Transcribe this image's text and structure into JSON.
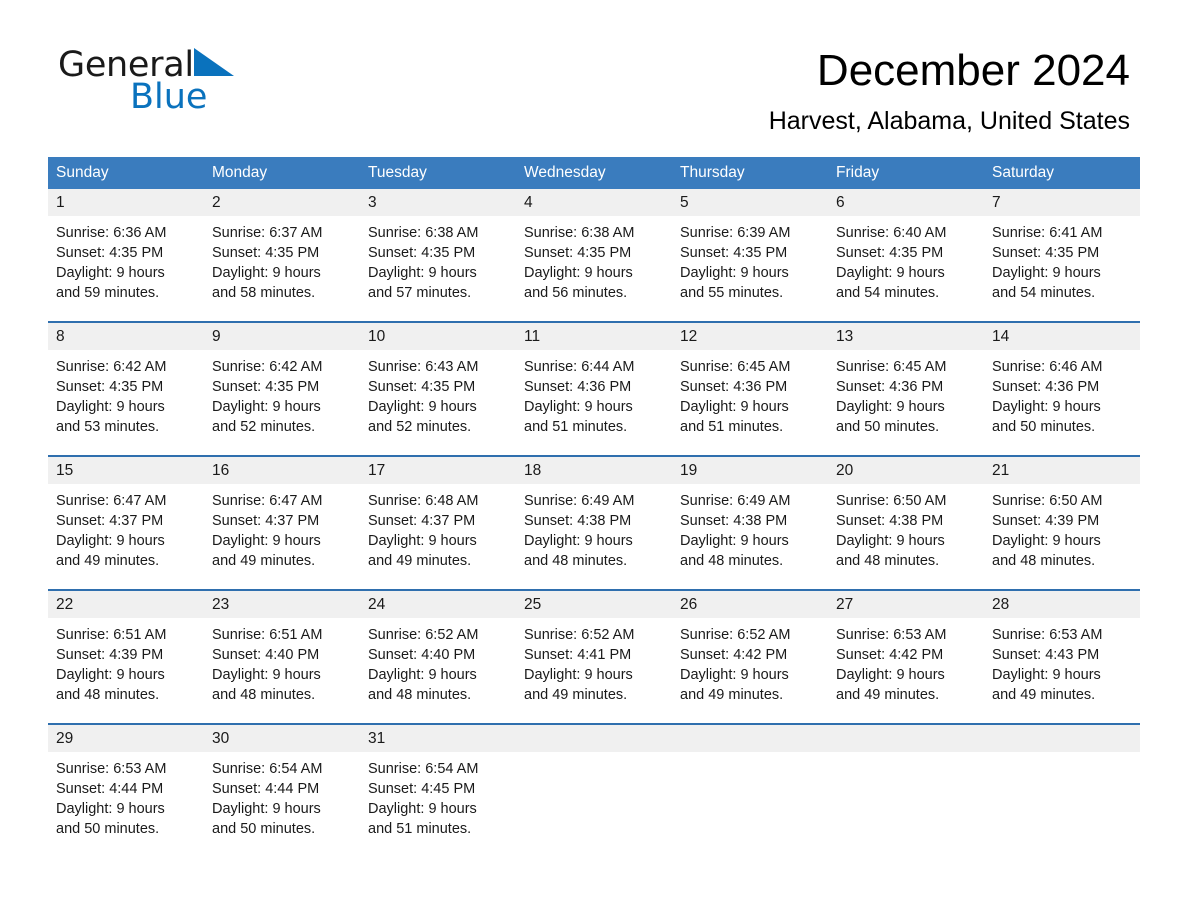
{
  "brand": {
    "name_part1": "General",
    "name_part2": "Blue",
    "triangle_icon": "blue-triangle-icon",
    "accent_color": "#0a72bd"
  },
  "header": {
    "title": "December 2024",
    "subtitle": "Harvest, Alabama, United States"
  },
  "calendar": {
    "header_bg": "#3a7cbe",
    "row_divider_color": "#2f6fae",
    "day_band_bg": "#f0f0f0",
    "weekdays": [
      "Sunday",
      "Monday",
      "Tuesday",
      "Wednesday",
      "Thursday",
      "Friday",
      "Saturday"
    ],
    "weeks": [
      [
        {
          "day": "1",
          "sunrise": "Sunrise: 6:36 AM",
          "sunset": "Sunset: 4:35 PM",
          "daylight1": "Daylight: 9 hours",
          "daylight2": "and 59 minutes."
        },
        {
          "day": "2",
          "sunrise": "Sunrise: 6:37 AM",
          "sunset": "Sunset: 4:35 PM",
          "daylight1": "Daylight: 9 hours",
          "daylight2": "and 58 minutes."
        },
        {
          "day": "3",
          "sunrise": "Sunrise: 6:38 AM",
          "sunset": "Sunset: 4:35 PM",
          "daylight1": "Daylight: 9 hours",
          "daylight2": "and 57 minutes."
        },
        {
          "day": "4",
          "sunrise": "Sunrise: 6:38 AM",
          "sunset": "Sunset: 4:35 PM",
          "daylight1": "Daylight: 9 hours",
          "daylight2": "and 56 minutes."
        },
        {
          "day": "5",
          "sunrise": "Sunrise: 6:39 AM",
          "sunset": "Sunset: 4:35 PM",
          "daylight1": "Daylight: 9 hours",
          "daylight2": "and 55 minutes."
        },
        {
          "day": "6",
          "sunrise": "Sunrise: 6:40 AM",
          "sunset": "Sunset: 4:35 PM",
          "daylight1": "Daylight: 9 hours",
          "daylight2": "and 54 minutes."
        },
        {
          "day": "7",
          "sunrise": "Sunrise: 6:41 AM",
          "sunset": "Sunset: 4:35 PM",
          "daylight1": "Daylight: 9 hours",
          "daylight2": "and 54 minutes."
        }
      ],
      [
        {
          "day": "8",
          "sunrise": "Sunrise: 6:42 AM",
          "sunset": "Sunset: 4:35 PM",
          "daylight1": "Daylight: 9 hours",
          "daylight2": "and 53 minutes."
        },
        {
          "day": "9",
          "sunrise": "Sunrise: 6:42 AM",
          "sunset": "Sunset: 4:35 PM",
          "daylight1": "Daylight: 9 hours",
          "daylight2": "and 52 minutes."
        },
        {
          "day": "10",
          "sunrise": "Sunrise: 6:43 AM",
          "sunset": "Sunset: 4:35 PM",
          "daylight1": "Daylight: 9 hours",
          "daylight2": "and 52 minutes."
        },
        {
          "day": "11",
          "sunrise": "Sunrise: 6:44 AM",
          "sunset": "Sunset: 4:36 PM",
          "daylight1": "Daylight: 9 hours",
          "daylight2": "and 51 minutes."
        },
        {
          "day": "12",
          "sunrise": "Sunrise: 6:45 AM",
          "sunset": "Sunset: 4:36 PM",
          "daylight1": "Daylight: 9 hours",
          "daylight2": "and 51 minutes."
        },
        {
          "day": "13",
          "sunrise": "Sunrise: 6:45 AM",
          "sunset": "Sunset: 4:36 PM",
          "daylight1": "Daylight: 9 hours",
          "daylight2": "and 50 minutes."
        },
        {
          "day": "14",
          "sunrise": "Sunrise: 6:46 AM",
          "sunset": "Sunset: 4:36 PM",
          "daylight1": "Daylight: 9 hours",
          "daylight2": "and 50 minutes."
        }
      ],
      [
        {
          "day": "15",
          "sunrise": "Sunrise: 6:47 AM",
          "sunset": "Sunset: 4:37 PM",
          "daylight1": "Daylight: 9 hours",
          "daylight2": "and 49 minutes."
        },
        {
          "day": "16",
          "sunrise": "Sunrise: 6:47 AM",
          "sunset": "Sunset: 4:37 PM",
          "daylight1": "Daylight: 9 hours",
          "daylight2": "and 49 minutes."
        },
        {
          "day": "17",
          "sunrise": "Sunrise: 6:48 AM",
          "sunset": "Sunset: 4:37 PM",
          "daylight1": "Daylight: 9 hours",
          "daylight2": "and 49 minutes."
        },
        {
          "day": "18",
          "sunrise": "Sunrise: 6:49 AM",
          "sunset": "Sunset: 4:38 PM",
          "daylight1": "Daylight: 9 hours",
          "daylight2": "and 48 minutes."
        },
        {
          "day": "19",
          "sunrise": "Sunrise: 6:49 AM",
          "sunset": "Sunset: 4:38 PM",
          "daylight1": "Daylight: 9 hours",
          "daylight2": "and 48 minutes."
        },
        {
          "day": "20",
          "sunrise": "Sunrise: 6:50 AM",
          "sunset": "Sunset: 4:38 PM",
          "daylight1": "Daylight: 9 hours",
          "daylight2": "and 48 minutes."
        },
        {
          "day": "21",
          "sunrise": "Sunrise: 6:50 AM",
          "sunset": "Sunset: 4:39 PM",
          "daylight1": "Daylight: 9 hours",
          "daylight2": "and 48 minutes."
        }
      ],
      [
        {
          "day": "22",
          "sunrise": "Sunrise: 6:51 AM",
          "sunset": "Sunset: 4:39 PM",
          "daylight1": "Daylight: 9 hours",
          "daylight2": "and 48 minutes."
        },
        {
          "day": "23",
          "sunrise": "Sunrise: 6:51 AM",
          "sunset": "Sunset: 4:40 PM",
          "daylight1": "Daylight: 9 hours",
          "daylight2": "and 48 minutes."
        },
        {
          "day": "24",
          "sunrise": "Sunrise: 6:52 AM",
          "sunset": "Sunset: 4:40 PM",
          "daylight1": "Daylight: 9 hours",
          "daylight2": "and 48 minutes."
        },
        {
          "day": "25",
          "sunrise": "Sunrise: 6:52 AM",
          "sunset": "Sunset: 4:41 PM",
          "daylight1": "Daylight: 9 hours",
          "daylight2": "and 49 minutes."
        },
        {
          "day": "26",
          "sunrise": "Sunrise: 6:52 AM",
          "sunset": "Sunset: 4:42 PM",
          "daylight1": "Daylight: 9 hours",
          "daylight2": "and 49 minutes."
        },
        {
          "day": "27",
          "sunrise": "Sunrise: 6:53 AM",
          "sunset": "Sunset: 4:42 PM",
          "daylight1": "Daylight: 9 hours",
          "daylight2": "and 49 minutes."
        },
        {
          "day": "28",
          "sunrise": "Sunrise: 6:53 AM",
          "sunset": "Sunset: 4:43 PM",
          "daylight1": "Daylight: 9 hours",
          "daylight2": "and 49 minutes."
        }
      ],
      [
        {
          "day": "29",
          "sunrise": "Sunrise: 6:53 AM",
          "sunset": "Sunset: 4:44 PM",
          "daylight1": "Daylight: 9 hours",
          "daylight2": "and 50 minutes."
        },
        {
          "day": "30",
          "sunrise": "Sunrise: 6:54 AM",
          "sunset": "Sunset: 4:44 PM",
          "daylight1": "Daylight: 9 hours",
          "daylight2": "and 50 minutes."
        },
        {
          "day": "31",
          "sunrise": "Sunrise: 6:54 AM",
          "sunset": "Sunset: 4:45 PM",
          "daylight1": "Daylight: 9 hours",
          "daylight2": "and 51 minutes."
        },
        {
          "day": "",
          "sunrise": "",
          "sunset": "",
          "daylight1": "",
          "daylight2": ""
        },
        {
          "day": "",
          "sunrise": "",
          "sunset": "",
          "daylight1": "",
          "daylight2": ""
        },
        {
          "day": "",
          "sunrise": "",
          "sunset": "",
          "daylight1": "",
          "daylight2": ""
        },
        {
          "day": "",
          "sunrise": "",
          "sunset": "",
          "daylight1": "",
          "daylight2": ""
        }
      ]
    ]
  }
}
